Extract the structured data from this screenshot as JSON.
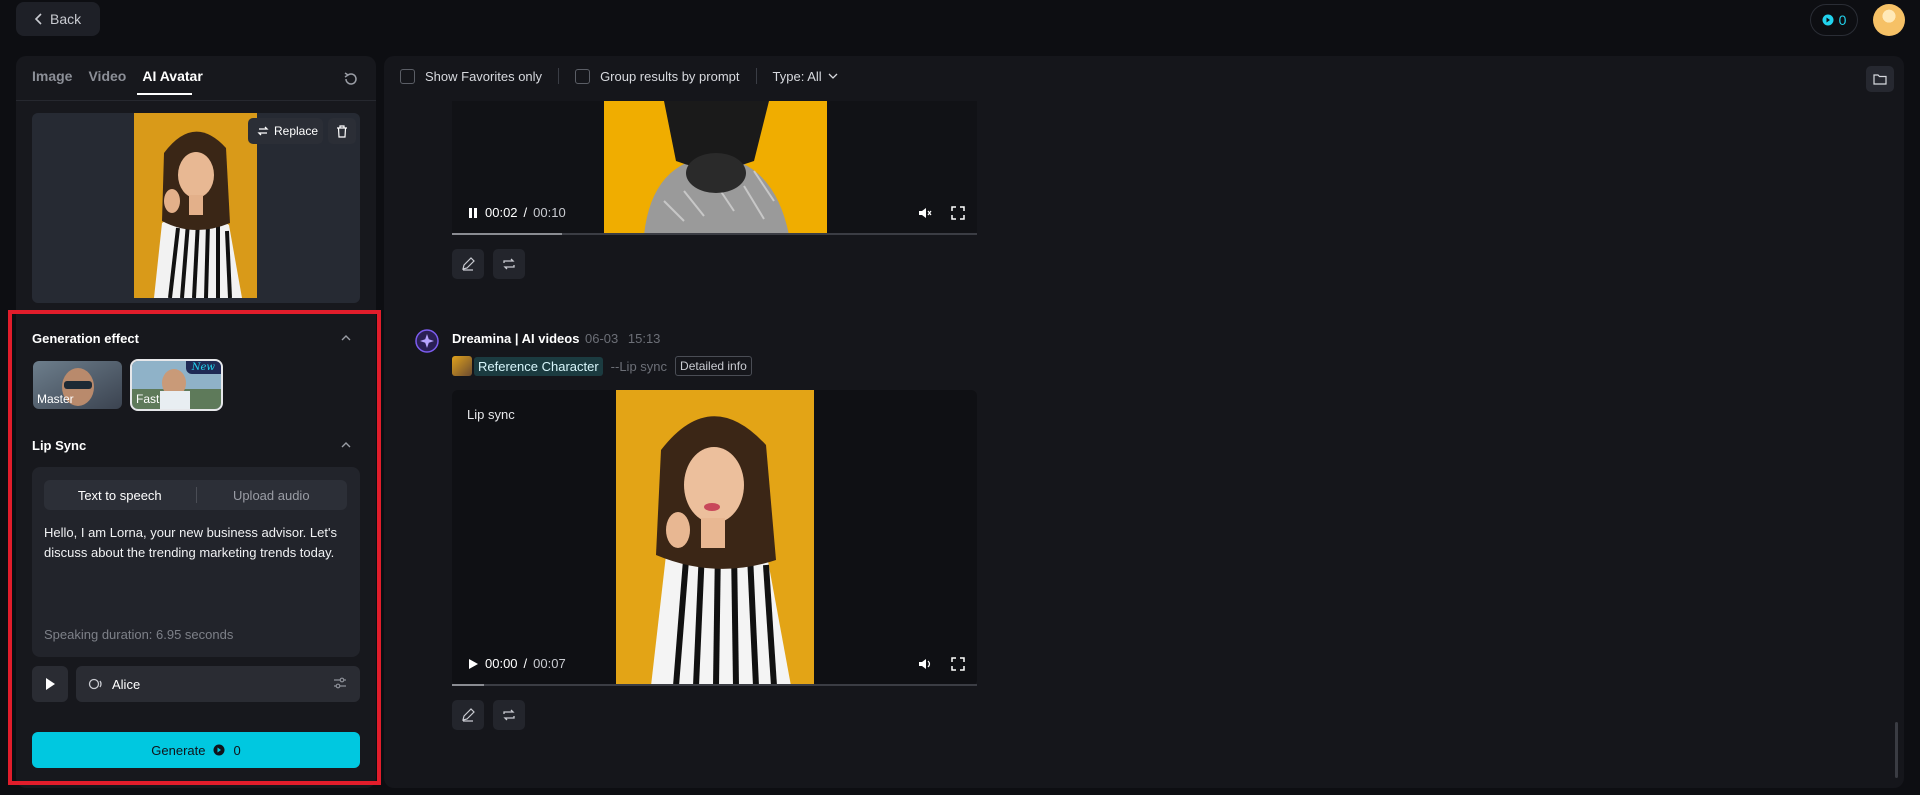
{
  "topbar": {
    "back_label": "Back",
    "credits": "0"
  },
  "left": {
    "tabs": [
      {
        "label": "Image",
        "active": false
      },
      {
        "label": "Video",
        "active": false
      },
      {
        "label": "AI Avatar",
        "active": true
      }
    ],
    "replace_label": "Replace",
    "generation_effect": {
      "title": "Generation effect",
      "options": [
        {
          "label": "Master",
          "selected": false
        },
        {
          "label": "Fast",
          "selected": true,
          "badge": "New"
        }
      ]
    },
    "lip_sync": {
      "title": "Lip Sync",
      "modes": [
        "Text to speech",
        "Upload audio"
      ],
      "active_mode": "Text to speech",
      "text": "Hello, I am Lorna, your new business advisor. Let's discuss about the trending marketing trends today.",
      "duration": "Speaking duration: 6.95 seconds",
      "voice": "Alice"
    },
    "generate": {
      "label": "Generate",
      "cost": "0"
    }
  },
  "right": {
    "filters": {
      "favorites_label": "Show Favorites only",
      "group_label": "Group results by prompt",
      "type_label": "Type: All"
    },
    "video1": {
      "current": "00:02",
      "separator": "/",
      "total": "00:10",
      "progress": 0.21
    },
    "entry": {
      "name": "Dreamina | AI videos",
      "date": "06-03",
      "time": "15:13",
      "ref_label": "Reference Character",
      "mode": "--Lip sync",
      "detail_label": "Detailed info",
      "overlay_label": "Lip sync"
    },
    "video2": {
      "current": "00:00",
      "separator": "/",
      "total": "00:07",
      "progress": 0.06
    }
  },
  "colors": {
    "accent": "#00c8e0",
    "highlight_frame": "#e11d2b",
    "panel": "#17181d"
  }
}
